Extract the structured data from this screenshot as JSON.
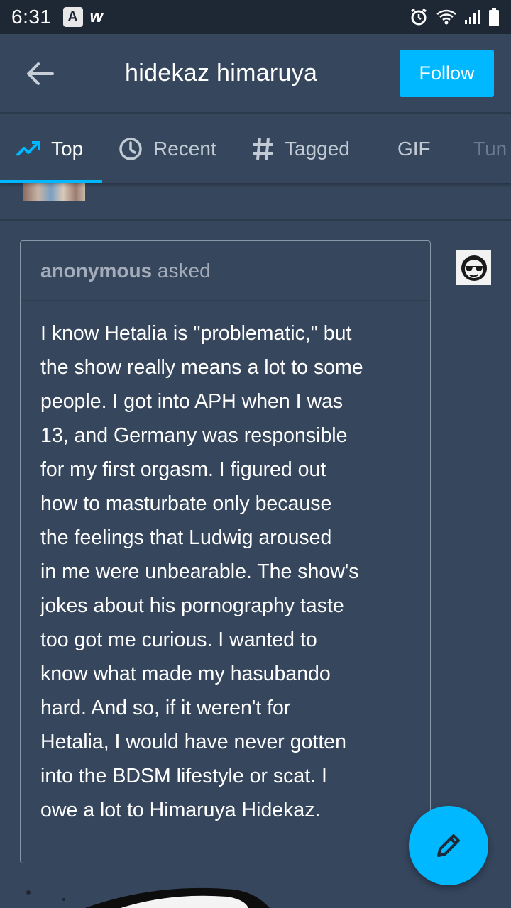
{
  "status_bar": {
    "time": "6:31",
    "icons": [
      "app-a-icon",
      "app-w-icon",
      "alarm-icon",
      "wifi-icon",
      "signal-icon",
      "battery-icon"
    ]
  },
  "header": {
    "title": "hidekaz himaruya",
    "follow_label": "Follow"
  },
  "tabs": [
    {
      "label": "Top",
      "icon": "trending-icon",
      "active": true
    },
    {
      "label": "Recent",
      "icon": "clock-icon",
      "active": false
    },
    {
      "label": "Tagged",
      "icon": "hash-icon",
      "active": false
    },
    {
      "label": "GIF",
      "icon": "",
      "active": false
    },
    {
      "label": "Tun",
      "icon": "",
      "active": false
    }
  ],
  "ask": {
    "asker": "anonymous",
    "verb": "asked",
    "body": "I know Hetalia is \"problematic,\" but\nthe show really means a lot to some\npeople. I got into APH when I was\n13, and Germany was responsible\nfor my first orgasm. I figured out\nhow to masturbate only because\nthe feelings that Ludwig aroused\nin me were unbearable. The show's\njokes about his pornography taste\ntoo got me curious. I wanted to\nknow what made my hasubando\nhard. And so, if it weren't for\nHetalia, I would have never gotten\ninto the BDSM lifestyle or scat. I\nowe a lot to Himaruya Hidekaz."
  },
  "colors": {
    "background": "#36465d",
    "status_bar": "#1e2835",
    "accent": "#00b8ff",
    "muted_text": "#a3acb8"
  }
}
